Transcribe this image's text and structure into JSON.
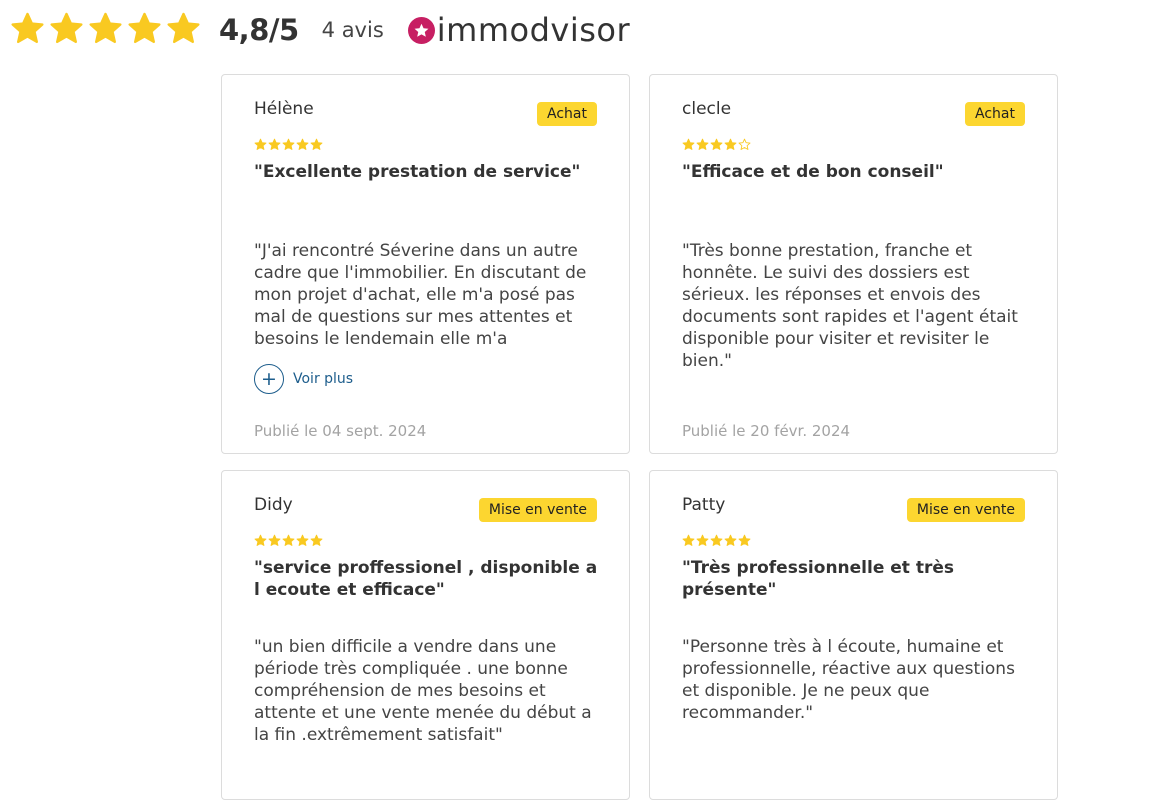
{
  "summary": {
    "stars": 5,
    "score": "4,8/5",
    "count": "4 avis",
    "brand": "immodvisor"
  },
  "colors": {
    "star": "#f9c921",
    "badge": "#fcd630",
    "brand": "#c71f63",
    "link": "#1d5d8c"
  },
  "reviews": [
    {
      "author": "Hélène",
      "type": "Achat",
      "rating": 5,
      "title": "\"Excellente prestation de service\"",
      "text": "\"J'ai rencontré Séverine dans un autre cadre que l'immobilier. En discutant de mon projet d'achat, elle m'a posé pas mal de questions sur mes attentes et besoins le lendemain elle m'a",
      "more_label": "Voir plus",
      "date": "Publié le 04 sept. 2024"
    },
    {
      "author": "clecle",
      "type": "Achat",
      "rating": 4,
      "title": "\"Efficace et de bon conseil\"",
      "text": "\"Très bonne prestation, franche et honnête. Le suivi des dossiers est sérieux. les réponses et envois des documents sont rapides et l'agent était disponible pour visiter et revisiter le bien.\"",
      "date": "Publié le 20 févr. 2024"
    },
    {
      "author": "Didy",
      "type": "Mise en vente",
      "rating": 5,
      "title": "\"service proffessionel , disponible a l ecoute et efficace\"",
      "text": "\"un bien difficile a vendre dans une période très compliquée . une bonne compréhension de mes besoins et attente et une vente menée du début a la fin .extrêmement satisfait\""
    },
    {
      "author": "Patty",
      "type": "Mise en vente",
      "rating": 5,
      "title": "\"Très professionnelle et très présente\"",
      "text": "\"Personne très à l écoute, humaine et professionnelle, réactive aux questions et disponible. Je ne peux que recommander.\""
    }
  ]
}
